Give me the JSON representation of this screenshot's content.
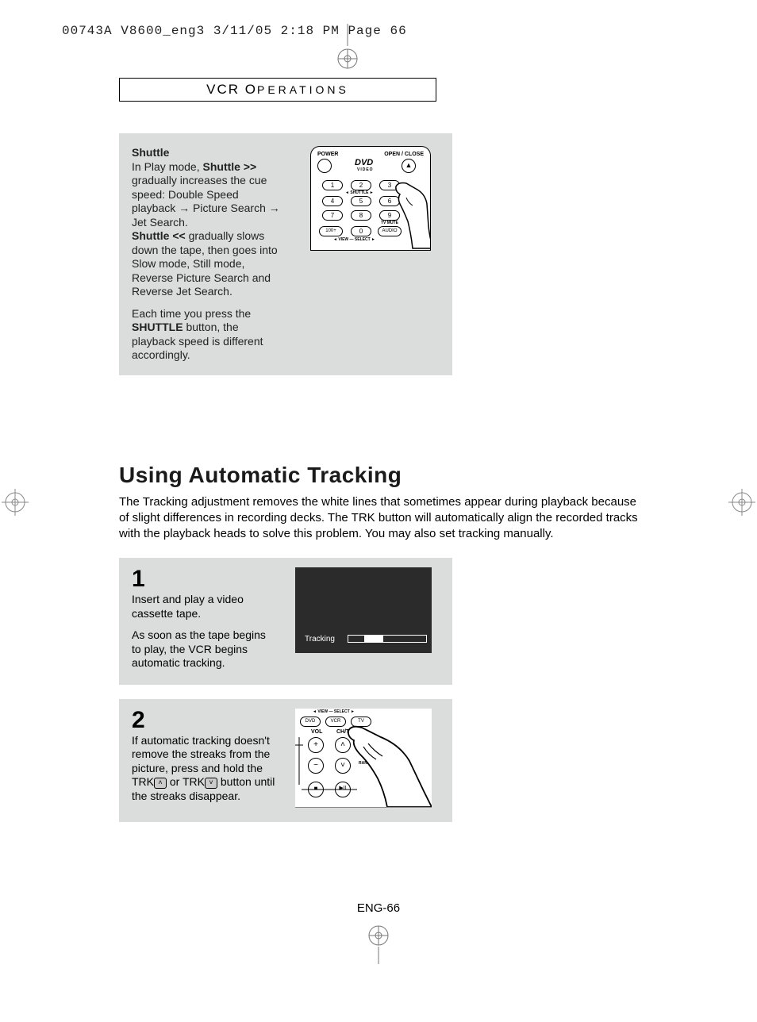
{
  "header_slug": "00743A V8600_eng3  3/11/05  2:18 PM  Page 66",
  "section_header": {
    "prefix": "VCR ",
    "caps": "O",
    "rest": "PERATIONS"
  },
  "shuttle": {
    "title": "Shuttle",
    "p1a": "In Play mode, ",
    "p1b": "Shuttle >>",
    "p1c": " gradually increases the cue speed: Double Speed playback ",
    "p1d": " Picture Search ",
    "p1e": " Jet Search.",
    "p2a": "Shuttle << ",
    "p2b": "gradually slows down the tape, then goes into Slow mode, Still mode, Reverse Picture Search and Reverse Jet Search.",
    "p3a": "Each time you press the ",
    "p3b": "SHUTTLE",
    "p3c": " button, the playback speed is different accordingly."
  },
  "remote_labels": {
    "power": "POWER",
    "open_close": "OPEN / CLOSE",
    "dvd": "DVD",
    "video": "VIDEO",
    "shuttle": "SHUTTLE",
    "tv_mute": "TV MUTE",
    "audio": "AUDIO",
    "hundred": "100+",
    "view": "VIEW",
    "select": "SELECT"
  },
  "tracking": {
    "title": "Using Automatic Tracking",
    "intro": "The Tracking adjustment removes the white lines that sometimes appear during playback because of slight differences in recording decks. The TRK button will automatically align the recorded tracks with the playback heads to solve this problem. You may also set tracking manually.",
    "step1": {
      "num": "1",
      "p1": "Insert and play a video cassette tape.",
      "p2": "As soon as the tape begins to play, the VCR begins automatic tracking.",
      "osd": "Tracking"
    },
    "step2": {
      "num": "2",
      "p1a": "If automatic tracking doesn't remove the streaks from the picture, press and hold the TRK",
      "p1b": " or TRK",
      "p1c": " button until the streaks disappear."
    }
  },
  "remote_mid_labels": {
    "view": "VIEW",
    "select": "SELECT",
    "dvd": "DVD",
    "vcr": "VCR",
    "tv": "TV",
    "vol": "VOL",
    "chtrk": "CH/TRK",
    "random_skip": "RANDOM SKIP"
  },
  "page_number": "ENG-66"
}
